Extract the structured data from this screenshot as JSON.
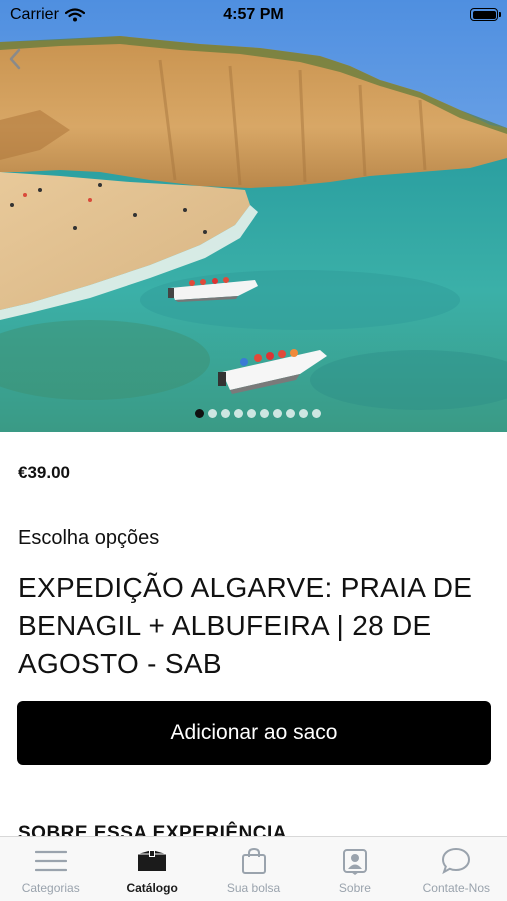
{
  "status_bar": {
    "carrier": "Carrier",
    "time": "4:57 PM"
  },
  "hero": {
    "slides_count": 10,
    "active_slide": 1
  },
  "product": {
    "price": "€39.00",
    "options_label": "Escolha opções",
    "title": "EXPEDIÇÃO ALGARVE: PRAIA DE BENAGIL + ALBUFEIRA | 28 DE AGOSTO - SAB",
    "add_button": "Adicionar ao saco",
    "section_heading": "SOBRE ESSA EXPERIÊNCIA"
  },
  "tabbar": {
    "items": [
      {
        "label": "Categorias",
        "icon": "menu-icon"
      },
      {
        "label": "Catálogo",
        "icon": "box-icon"
      },
      {
        "label": "Sua bolsa",
        "icon": "bag-icon"
      },
      {
        "label": "Sobre",
        "icon": "profile-card-icon"
      },
      {
        "label": "Contate-Nos",
        "icon": "chat-bubble-icon"
      }
    ],
    "active_index": 1
  }
}
